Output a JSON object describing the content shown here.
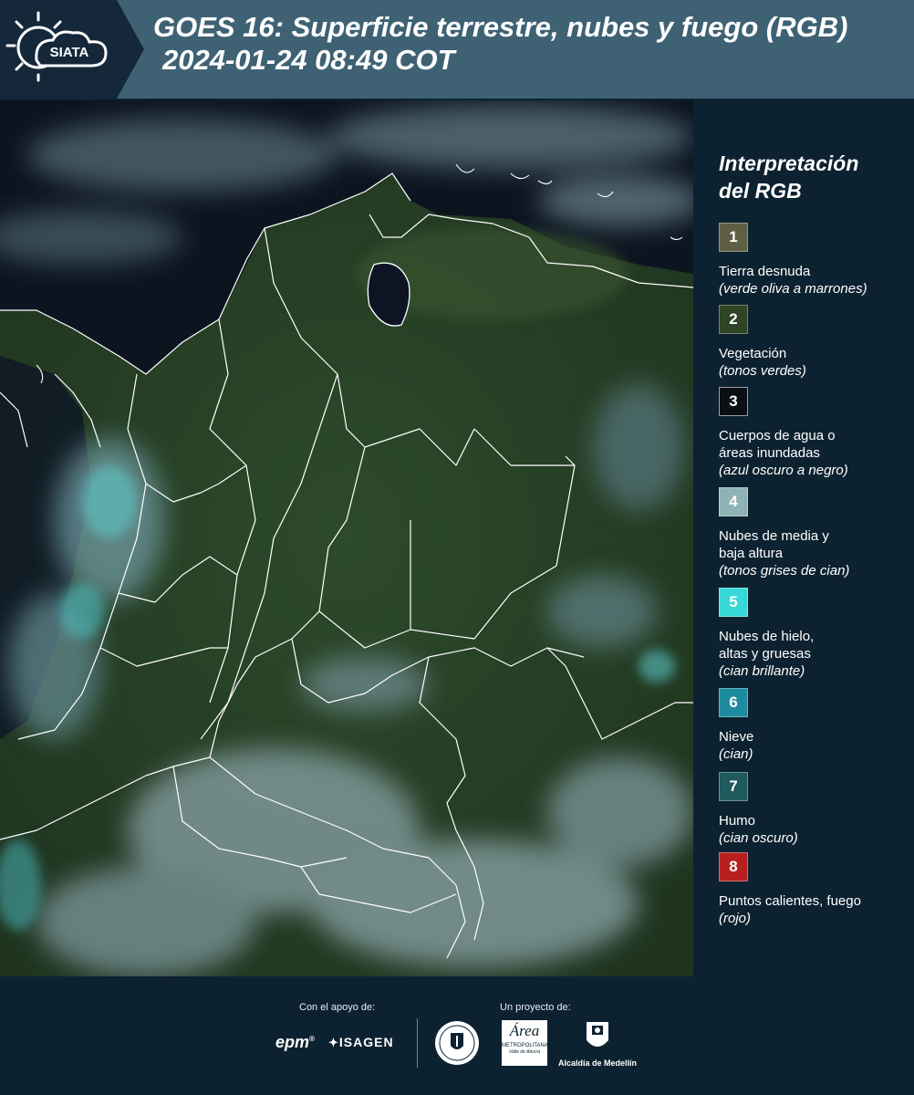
{
  "header": {
    "logo_text": "SIATA",
    "title_line1": "GOES 16: Superficie terrestre, nubes y fuego (RGB)",
    "title_line2": "2024-01-24 08:49 COT",
    "background_color": "#3e6274",
    "logo_plate_color": "#14283a"
  },
  "map": {
    "content": "satellite-rgb-composite",
    "boundary_color": "#ffffff"
  },
  "legend": {
    "title_line1": "Interpretación",
    "title_line2": "del RGB",
    "items": [
      {
        "number": "1",
        "label": "Tierra desnuda",
        "note": "(verde oliva a marrones)",
        "color": "#5e5f45"
      },
      {
        "number": "2",
        "label": "Vegetación",
        "note": "(tonos verdes)",
        "color": "#2e4424"
      },
      {
        "number": "3",
        "label": "Cuerpos de agua o",
        "label2": "áreas inundadas",
        "note": "(azul oscuro a negro)",
        "color": "#0a0f16"
      },
      {
        "number": "4",
        "label": "Nubes de media y",
        "label2": "baja altura",
        "note": "(tonos grises de cian)",
        "color": "#8fb3b5"
      },
      {
        "number": "5",
        "label": "Nubes de hielo,",
        "label2": "altas y gruesas",
        "note": "(cian brillante)",
        "color": "#38d8d8"
      },
      {
        "number": "6",
        "label": "Nieve",
        "note": "(cian)",
        "color": "#1e8b9e"
      },
      {
        "number": "7",
        "label": "Humo",
        "note": "(cian oscuro)",
        "color": "#1f5a5c"
      },
      {
        "number": "8",
        "label": "Puntos calientes, fuego",
        "note": "(rojo)",
        "color": "#b81f1f"
      }
    ]
  },
  "footer": {
    "support_caption": "Con el apoyo de:",
    "project_caption": "Un proyecto de:",
    "sponsor_epm": "epm",
    "sponsor_isagen": "ISAGEN",
    "partner_area_line1": "METROPOLITANA",
    "partner_area_line2": "Valle de Aburrá",
    "partner_area_brand": "Área",
    "partner_alcaldia": "Alcaldía de Medellín"
  }
}
